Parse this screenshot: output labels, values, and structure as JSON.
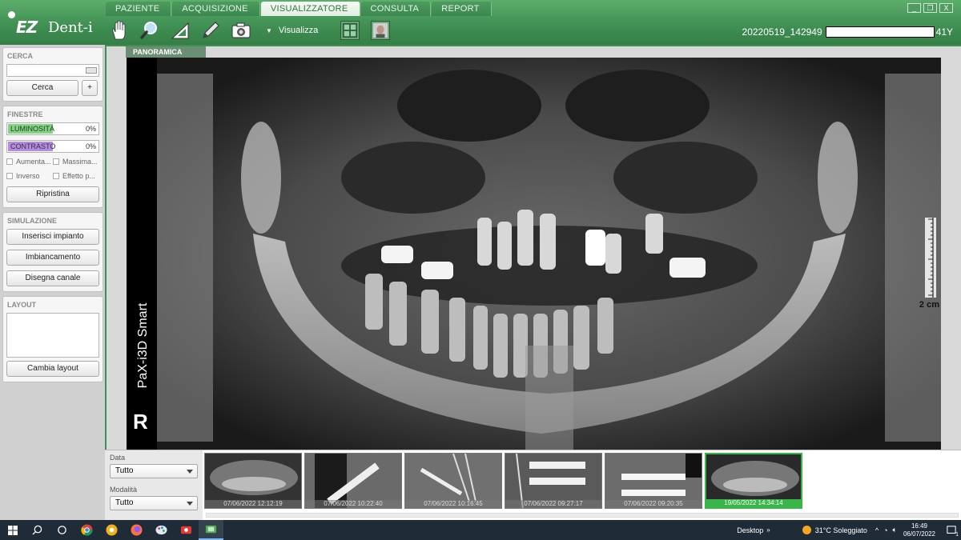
{
  "app": {
    "logo_ez": "EZ",
    "logo_dent": "Dent-i"
  },
  "tabs": [
    {
      "label": "PAZIENTE",
      "active": false
    },
    {
      "label": "ACQUISIZIONE",
      "active": false
    },
    {
      "label": "VISUALIZZATORE",
      "active": true
    },
    {
      "label": "CONSULTA",
      "active": false
    },
    {
      "label": "REPORT",
      "active": false
    }
  ],
  "toolbar": {
    "tools": [
      "hand-pan-icon",
      "magnifier-icon",
      "ruler-angle-icon",
      "pencil-icon",
      "camera-capture-icon"
    ],
    "visualizza_label": "Visualizza",
    "extra_buttons": [
      "grid-view-icon",
      "face-photo-icon"
    ]
  },
  "patient": {
    "id": "20220519_142949",
    "age": "41Y"
  },
  "window_controls": [
    "_",
    "❐",
    "X"
  ],
  "sidebar": {
    "cerca": {
      "title": "CERCA",
      "input_value": "",
      "search_button": "Cerca",
      "add_button": "+"
    },
    "finestre": {
      "title": "FINESTRE",
      "luminosita_label": "LUMINOSITÀ",
      "luminosita_value": "0%",
      "luminosita_color": "#7ed67e",
      "contrasto_label": "CONTRASTO",
      "contrasto_value": "0%",
      "contrasto_color": "#b58be6",
      "checks": [
        "Aumenta...",
        "Massima...",
        "Inverso",
        "Effetto p..."
      ],
      "reset_button": "Ripristina"
    },
    "simulazione": {
      "title": "SIMULAZIONE",
      "buttons": [
        "Inserisci impianto",
        "Imbiancamento",
        "Disegna canale"
      ]
    },
    "layout": {
      "title": "LAYOUT",
      "button": "Cambia layout"
    }
  },
  "viewer": {
    "view_tab": "PANORAMICA",
    "device_label": "PaX-i3D Smart",
    "side_marker": "R",
    "scale_label": "2 cm"
  },
  "bottom": {
    "data_label": "Data",
    "data_value": "Tutto",
    "modalita_label": "Modalità",
    "modalita_value": "Tutto",
    "thumbnails": [
      {
        "date": "07/06/2022 12:12:19",
        "kind": "panoramic",
        "selected": false
      },
      {
        "date": "07/06/2022 10:22:40",
        "kind": "intraoral",
        "selected": false
      },
      {
        "date": "07/06/2022 10:16:45",
        "kind": "intraoral",
        "selected": false
      },
      {
        "date": "07/06/2022 09:27:17",
        "kind": "intraoral",
        "selected": false
      },
      {
        "date": "07/06/2022 09:20:35",
        "kind": "intraoral",
        "selected": false
      },
      {
        "date": "19/05/2022 14:34:14",
        "kind": "panoramic",
        "selected": true
      }
    ]
  },
  "taskbar": {
    "desktop_label": "Desktop",
    "weather": "31°C  Soleggiato",
    "time": "16:49",
    "date": "06/07/2022",
    "notif_count": "1"
  }
}
